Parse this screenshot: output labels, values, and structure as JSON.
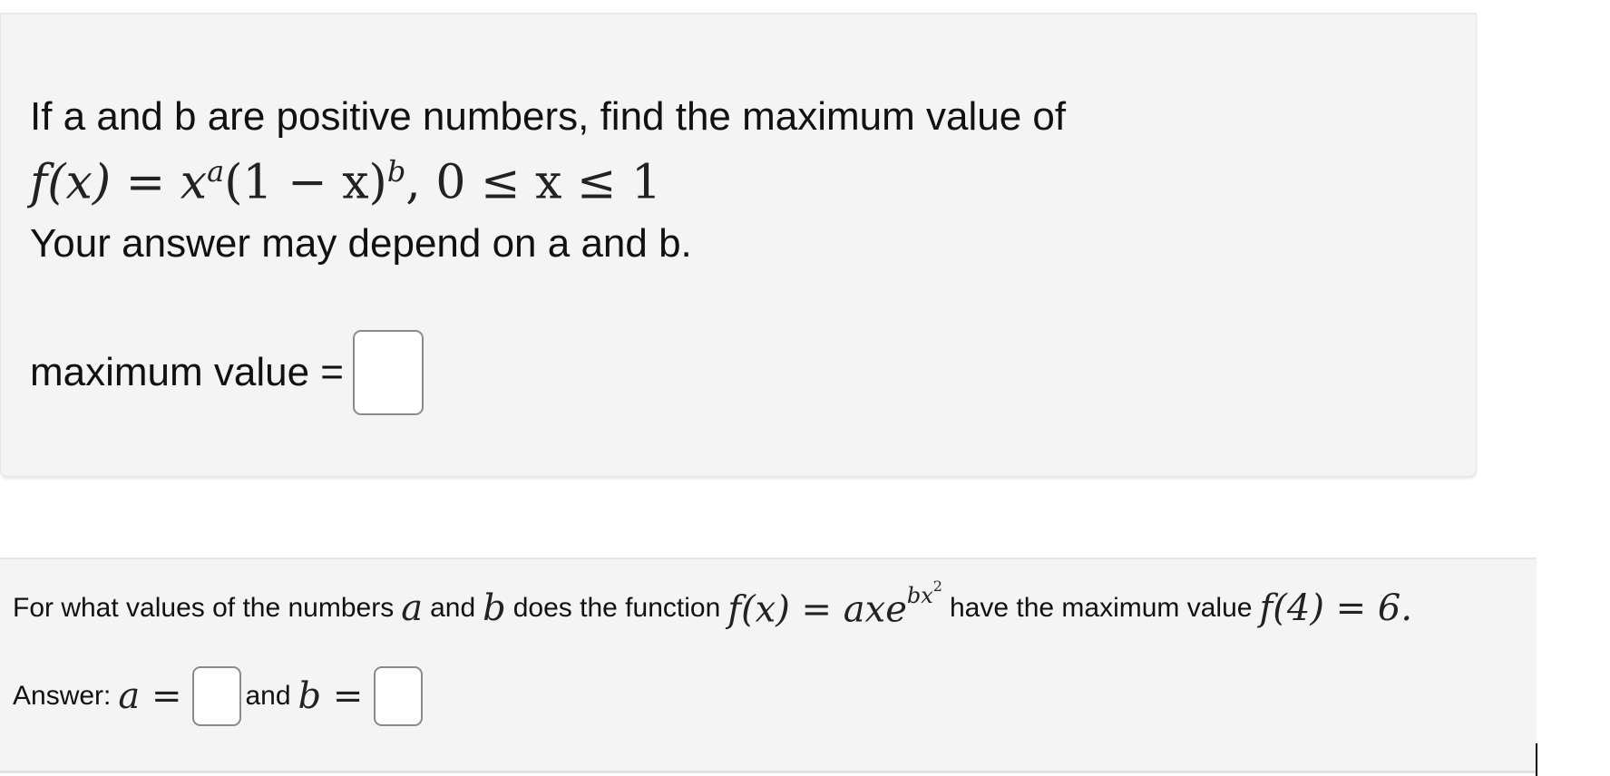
{
  "question1": {
    "prompt": "If a and b are positive numbers, find the maximum value of",
    "formula": {
      "lhs": "f(x) = ",
      "base": "x",
      "exp_a": "a",
      "factor": "(1 − x)",
      "exp_b": "b",
      "domain": ",  0 ≤ x ≤ 1"
    },
    "note": "Your answer may depend on a and b.",
    "answer_label": "maximum value =",
    "answer_value": ""
  },
  "question2": {
    "prompt_start": "For what values of the numbers",
    "var_a": "a",
    "and_1": "and",
    "var_b": "b",
    "prompt_mid": "does the function",
    "function_lhs": "f(x) = axe",
    "function_exp": "bx",
    "function_exp_power": "2",
    "prompt_mid2": "have the maximum value",
    "max_expr": "f(4) = 6.",
    "answer_label": "Answer:",
    "a_eq": "a =",
    "and_2": "and",
    "b_eq": "b =",
    "a_value": "",
    "b_value": ""
  },
  "colors": {
    "panel_bg": "#f4f4f4",
    "input_border": "#8a8a8a",
    "text": "#111111"
  }
}
